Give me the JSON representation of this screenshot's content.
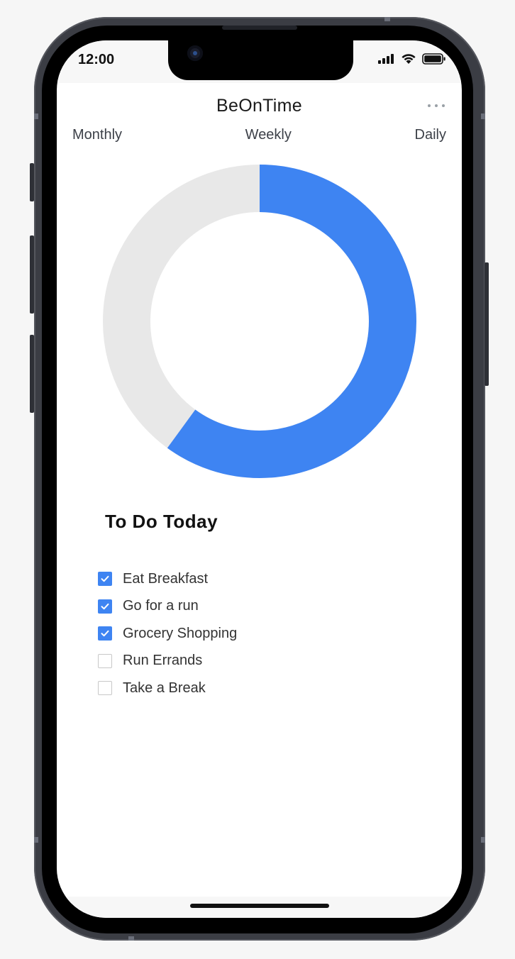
{
  "status_bar": {
    "time": "12:00",
    "icons": [
      "signal-icon",
      "wifi-icon",
      "battery-icon"
    ]
  },
  "header": {
    "title": "BeOnTime",
    "menu_icon": "more-horizontal-icon"
  },
  "tabs": [
    {
      "label": "Monthly"
    },
    {
      "label": "Weekly"
    },
    {
      "label": "Daily"
    }
  ],
  "progress": {
    "completed_fraction": 0.6,
    "completed_color": "#3e84f2",
    "remaining_color": "#e8e8e8"
  },
  "todo": {
    "title": "To Do Today",
    "items": [
      {
        "label": "Eat Breakfast",
        "checked": true
      },
      {
        "label": "Go for a run",
        "checked": true
      },
      {
        "label": "Grocery Shopping",
        "checked": true
      },
      {
        "label": "Run Errands",
        "checked": false
      },
      {
        "label": "Take a Break",
        "checked": false
      }
    ]
  }
}
